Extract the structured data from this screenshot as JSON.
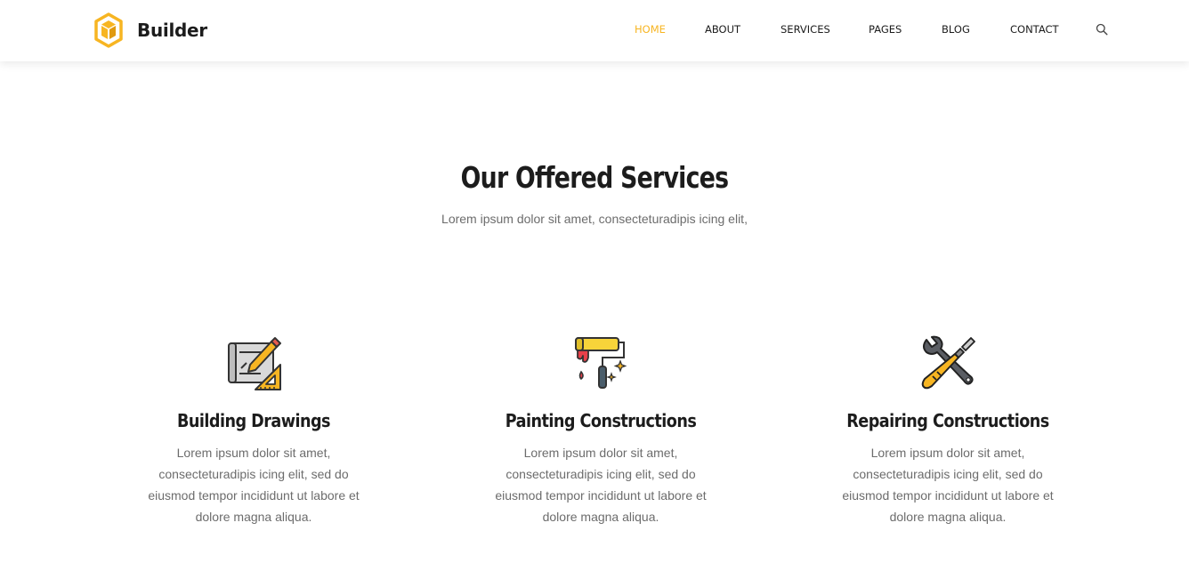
{
  "brand": {
    "name": "Builder",
    "logo_icon": "hexagon-box-icon",
    "accent": "#f7b522"
  },
  "nav": {
    "items": [
      {
        "label": "HOME",
        "active": true
      },
      {
        "label": "ABOUT",
        "active": false
      },
      {
        "label": "SERVICES",
        "active": false
      },
      {
        "label": "PAGES",
        "active": false
      },
      {
        "label": "BLOG",
        "active": false
      },
      {
        "label": "CONTACT",
        "active": false
      }
    ],
    "search_icon": "search-icon"
  },
  "section": {
    "title": "Our Offered Services",
    "subtitle": "Lorem ipsum dolor sit amet, consecteturadipis icing elit,"
  },
  "services": [
    {
      "icon": "blueprint-ruler-icon",
      "title": "Building Drawings",
      "description": "Lorem ipsum dolor sit amet, consecteturadipis icing elit, sed do eiusmod tempor incididunt ut labore et dolore magna aliqua."
    },
    {
      "icon": "paint-roller-icon",
      "title": "Painting Constructions",
      "description": "Lorem ipsum dolor sit amet, consecteturadipis icing elit, sed do eiusmod tempor incididunt ut labore et dolore magna aliqua."
    },
    {
      "icon": "wrench-screwdriver-icon",
      "title": "Repairing Constructions",
      "description": "Lorem ipsum dolor sit amet, consecteturadipis icing elit, sed do eiusmod tempor incididunt ut labore et dolore magna aliqua."
    }
  ]
}
